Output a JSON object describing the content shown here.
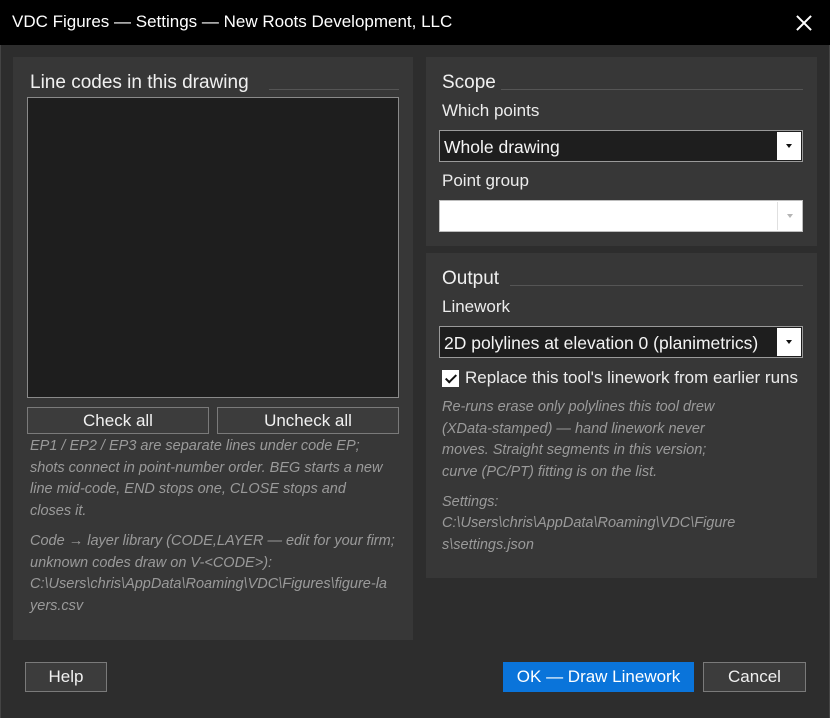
{
  "window": {
    "title": "VDC Figures — Settings — New Roots Development, LLC"
  },
  "line_codes": {
    "title": "Line codes in this drawing",
    "check_all": "Check all",
    "uncheck_all": "Uncheck all",
    "note1": "EP1 / EP2 / EP3 are separate lines under code EP; shots connect in point-number order. BEG starts a new line mid-code, END stops one, CLOSE stops and closes it.",
    "note2_line1": "Code → layer library (CODE,LAYER — edit for your firm; unknown codes draw on V-<CODE>):",
    "note2_path": "C:\\Users\\chris\\AppData\\Roaming\\VDC\\Figures\\figure-layers.csv"
  },
  "scope": {
    "title": "Scope",
    "which_points_label": "Which points",
    "which_points_value": "Whole drawing",
    "point_group_label": "Point group",
    "point_group_value": ""
  },
  "output": {
    "title": "Output",
    "linework_label": "Linework",
    "linework_value": "2D polylines at elevation 0 (planimetrics)",
    "replace_label": "Replace this tool's linework from earlier runs",
    "replace_checked": true,
    "note": "Re-runs erase only polylines this tool drew  (XData-stamped) — hand linework never moves. Straight segments in this version; curve (PC/PT) fitting is on the list.",
    "settings_label": "Settings:",
    "settings_path": "C:\\Users\\chris\\AppData\\Roaming\\VDC\\Figures\\settings.json"
  },
  "footer": {
    "help": "Help",
    "ok": "OK — Draw Linework",
    "cancel": "Cancel"
  }
}
